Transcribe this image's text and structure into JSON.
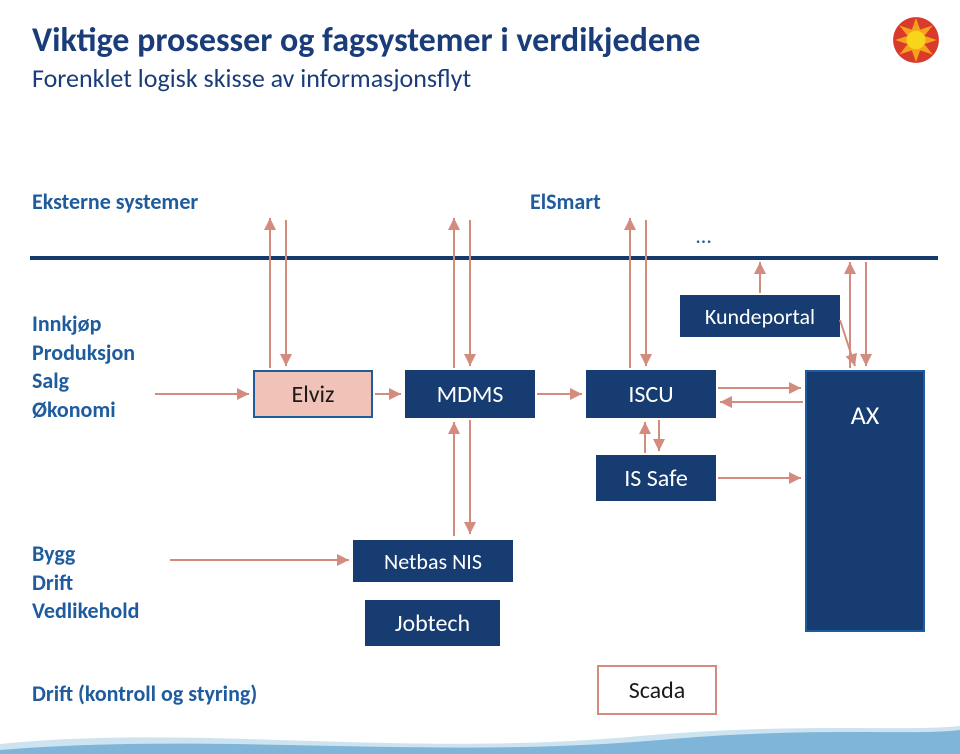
{
  "title": "Viktige prosesser og fagsystemer i verdikjedene",
  "subtitle": "Forenklet logisk skisse av informasjonsflyt",
  "external_band": {
    "label": "Eksterne systemer",
    "node": "ElSmart",
    "ellipsis": "…"
  },
  "left_groups": {
    "group1": [
      "Innkjøp",
      "Produksjon",
      "Salg",
      "Økonomi"
    ],
    "group2": [
      "Bygg",
      "Drift",
      "Vedlikehold"
    ],
    "group3": "Drift (kontroll og styring)"
  },
  "boxes": {
    "elviz": "Elviz",
    "mdms": "MDMS",
    "iscu": "ISCU",
    "kundeportal": "Kundeportal",
    "is_safe": "IS Safe",
    "ax": "AX",
    "netbas": "Netbas NIS",
    "jobtech": "Jobtech",
    "scada": "Scada"
  },
  "colors": {
    "text_heading": "#1a3d7a",
    "text_label": "#1f5c9e",
    "box_dark_fill": "#163c72",
    "box_light_fill": "#f0c2b8",
    "box_light_border": "#1f5c9e",
    "box_pink_border": "#d28b7c",
    "arrow_stroke": "#d28b7c",
    "divider": "#173a6c",
    "wave1": "#7fb5d8",
    "wave2": "#cde3ef"
  }
}
